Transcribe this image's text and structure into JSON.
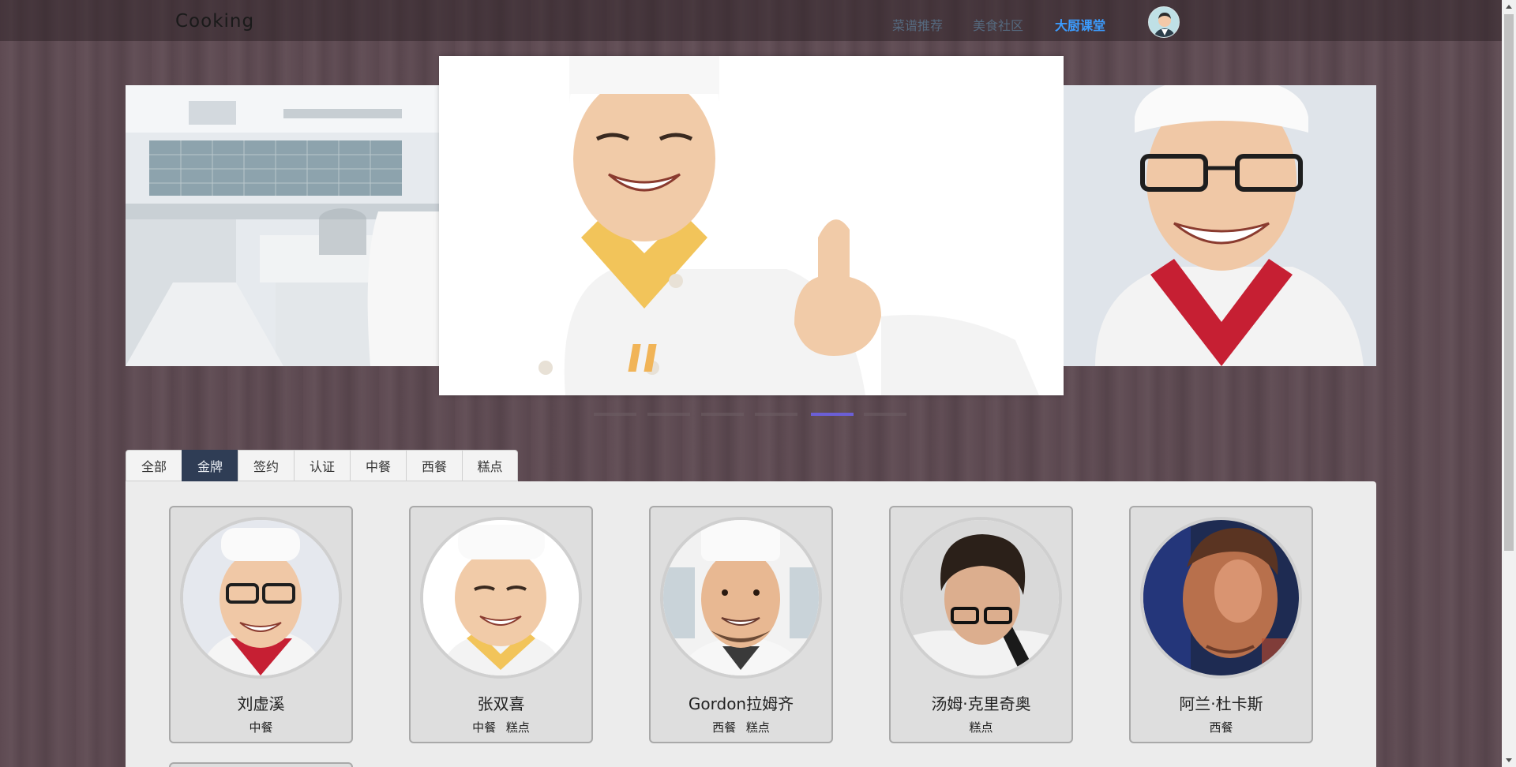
{
  "header": {
    "logo": "Cooking",
    "nav": [
      {
        "label": "菜谱推荐",
        "active": false
      },
      {
        "label": "美食社区",
        "active": false
      },
      {
        "label": "大厨课堂",
        "active": true
      }
    ],
    "avatar_icon": "user-avatar-icon"
  },
  "carousel": {
    "slides": [
      "kitchen-chef-image",
      "thumbs-up-chef-image",
      "glasses-chef-image"
    ],
    "indicator_count": 6,
    "active_indicator": 5
  },
  "tabs": [
    {
      "label": "全部",
      "active": false
    },
    {
      "label": "金牌",
      "active": true
    },
    {
      "label": "签约",
      "active": false
    },
    {
      "label": "认证",
      "active": false
    },
    {
      "label": "中餐",
      "active": false
    },
    {
      "label": "西餐",
      "active": false
    },
    {
      "label": "糕点",
      "active": false
    }
  ],
  "chefs": [
    {
      "name": "刘虚溪",
      "tags": [
        "中餐"
      ]
    },
    {
      "name": "张双喜",
      "tags": [
        "中餐",
        "糕点"
      ]
    },
    {
      "name": "Gordon拉姆齐",
      "tags": [
        "西餐",
        "糕点"
      ]
    },
    {
      "name": "汤姆·克里奇奥",
      "tags": [
        "糕点"
      ]
    },
    {
      "name": "阿兰·杜卡斯",
      "tags": [
        "西餐"
      ]
    }
  ],
  "colors": {
    "active_nav": "#3b9cff",
    "active_tab": "#2f3d55",
    "active_indicator": "#6b5fd6"
  }
}
